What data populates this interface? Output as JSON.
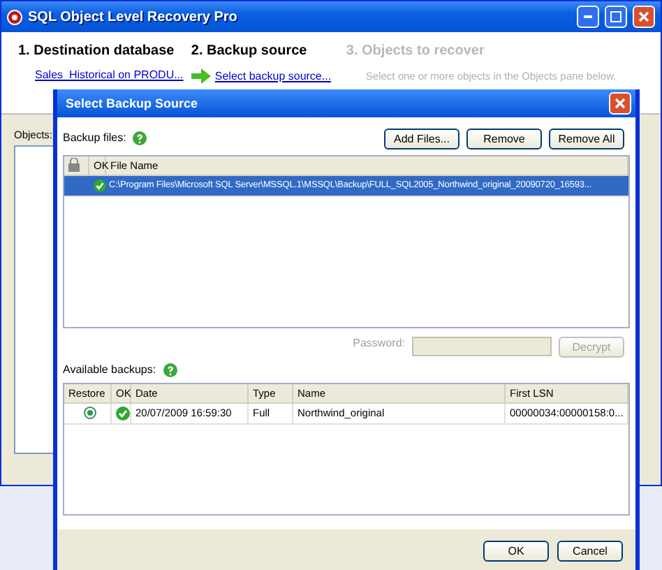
{
  "window": {
    "title": "SQL Object Level Recovery Pro"
  },
  "steps": [
    {
      "title": "1. Destination database",
      "link": "Sales_Historical on PRODU...",
      "current": false,
      "disabled": false
    },
    {
      "title": "2. Backup source",
      "link": "Select backup source...",
      "current": true,
      "disabled": false
    },
    {
      "title": "3. Objects to recover",
      "note": "Select one or more objects in the Objects pane below.",
      "current": false,
      "disabled": true
    }
  ],
  "objects_label": "Objects:",
  "dialog": {
    "title": "Select Backup Source",
    "backup_files_label": "Backup files:",
    "file_buttons": [
      "Add Files...",
      "Remove",
      "Remove All"
    ],
    "files_columns": [
      "OK",
      "File Name"
    ],
    "files": [
      {
        "ok": true,
        "selected": true,
        "name": "C:\\Program Files\\Microsoft SQL Server\\MSSQL.1\\MSSQL\\Backup\\FULL_SQL2005_Northwind_original_20090720_16593..."
      }
    ],
    "password_label": "Password:",
    "password_disabled": true,
    "decrypt_button": "Decrypt",
    "available_label": "Available backups:",
    "backups_columns": [
      "Restore",
      "OK",
      "Date",
      "Type",
      "Name",
      "First LSN"
    ],
    "backups": [
      {
        "restore": true,
        "ok": true,
        "date": "20/07/2009 16:59:30",
        "type": "Full",
        "name": "Northwind_original",
        "first_lsn": "00000034:00000158:0..."
      }
    ],
    "buttons": [
      "OK",
      "Cancel"
    ]
  }
}
